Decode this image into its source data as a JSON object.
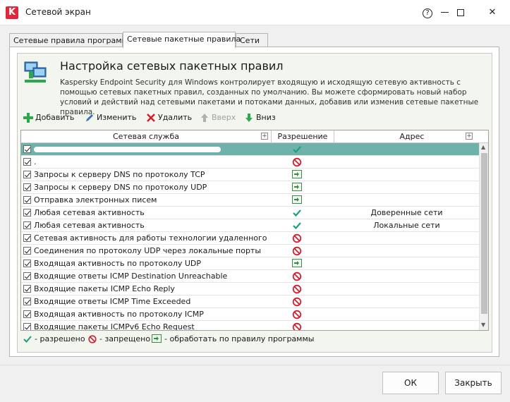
{
  "window": {
    "title": "Сетевой экран",
    "logo_text": "K",
    "help_label": "?",
    "minimize_label": "☐",
    "close_label": "✕"
  },
  "tabs": [
    {
      "label": "Сетевые правила программ"
    },
    {
      "label": "Сетевые пакетные правила"
    },
    {
      "label": "Сети"
    }
  ],
  "header": {
    "title": "Настройка сетевых пакетных правил",
    "description": "Kaspersky Endpoint Security для Windows контролирует входящую и исходящую сетевую активность с помощью сетевых пакетных правил, созданных по умолчанию. Вы можете сформировать новый набор условий и действий над сетевыми пакетами и потоками данных, добавив или изменив сетевые пакетные правила."
  },
  "toolbar": {
    "add": "Добавить",
    "edit": "Изменить",
    "delete": "Удалить",
    "up": "Вверх",
    "down": "Вниз"
  },
  "columns": {
    "service": "Сетевая служба",
    "permission": "Разрешение",
    "address": "Адрес",
    "plus": "+"
  },
  "rows": [
    {
      "service": "",
      "permission": "allow",
      "address": "",
      "selected": true
    },
    {
      "service": ".",
      "permission": "deny",
      "address": ""
    },
    {
      "service": "Запросы к серверу DNS по протоколу TCP",
      "permission": "app",
      "address": ""
    },
    {
      "service": "Запросы к серверу DNS по протоколу UDP",
      "permission": "app",
      "address": ""
    },
    {
      "service": "Отправка электронных писем",
      "permission": "app",
      "address": ""
    },
    {
      "service": "Любая сетевая активность",
      "permission": "allow",
      "address": "Доверенные сети"
    },
    {
      "service": "Любая сетевая активность",
      "permission": "allow",
      "address": "Локальные сети"
    },
    {
      "service": "Сетевая активность для работы технологии удаленного раб...",
      "permission": "deny",
      "address": ""
    },
    {
      "service": "Соединения по протоколу UDP через локальные порты",
      "permission": "deny",
      "address": ""
    },
    {
      "service": "Входящая активность по протоколу UDP",
      "permission": "app",
      "address": ""
    },
    {
      "service": "Входящие ответы ICMP Destination Unreachable",
      "permission": "deny",
      "address": ""
    },
    {
      "service": "Входящие пакеты ICMP Echo Reply",
      "permission": "deny",
      "address": ""
    },
    {
      "service": "Входящие ответы ICMP Time Exceeded",
      "permission": "deny",
      "address": ""
    },
    {
      "service": "Входящая активность по протоколу ICMP",
      "permission": "deny",
      "address": ""
    },
    {
      "service": "Входящие пакеты ICMPv6 Echo Request",
      "permission": "deny",
      "address": ""
    }
  ],
  "legend": {
    "allowed": "- разрешено",
    "denied": "- запрещено",
    "app_rule": "- обработать по правилу программы"
  },
  "buttons": {
    "ok": "ОК",
    "close": "Закрыть"
  },
  "colors": {
    "selected_row": "#6fb2ac",
    "allow": "#1aa07b",
    "deny": "#d0202e",
    "brand": "#e0283d"
  }
}
